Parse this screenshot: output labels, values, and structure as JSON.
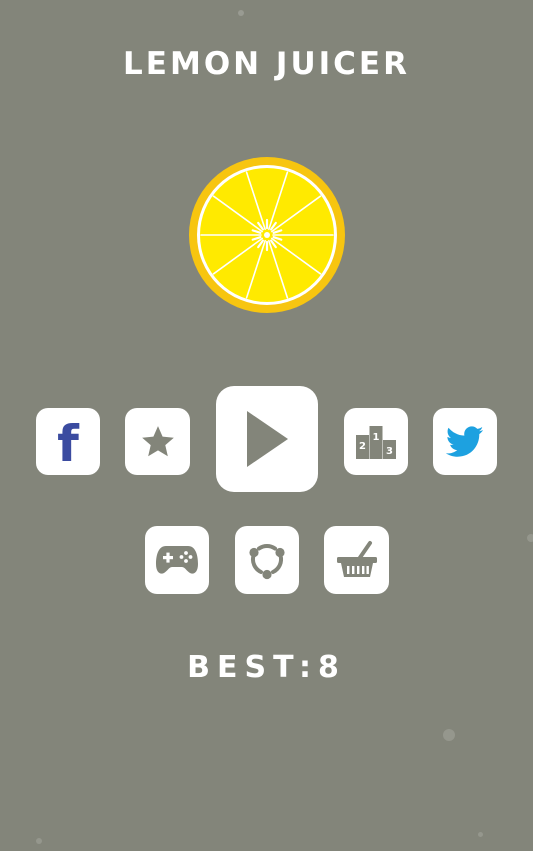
{
  "title": "LEMON JUICER",
  "colors": {
    "background": "#83857a",
    "button": "#ffffff",
    "icon_gray": "#83857a",
    "facebook": "#3b4ba0",
    "twitter": "#1da1e0",
    "lemon_rind": "#f7c510",
    "lemon_flesh": "#ffea00"
  },
  "buttons": {
    "facebook": {
      "icon": "facebook-icon",
      "glyph": "f"
    },
    "rate": {
      "icon": "star-icon"
    },
    "play": {
      "icon": "play-icon"
    },
    "leaderboard": {
      "icon": "podium-icon",
      "ranks": [
        "2",
        "1",
        "3"
      ]
    },
    "twitter": {
      "icon": "twitter-bird-icon"
    },
    "more_games": {
      "icon": "gamepad-icon"
    },
    "share": {
      "icon": "share-icon"
    },
    "shop": {
      "icon": "basket-icon"
    }
  },
  "best": {
    "label": "BEST",
    "separator": ":",
    "value": "8"
  }
}
